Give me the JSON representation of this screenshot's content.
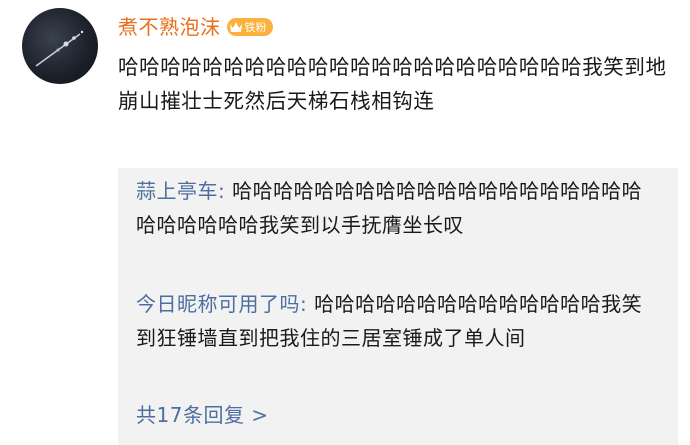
{
  "comment": {
    "username": "煮不熟泡沫",
    "badge_label": "铁粉",
    "avatar_icon": "avatar-icon",
    "text": "哈哈哈哈哈哈哈哈哈哈哈哈哈哈哈哈哈哈哈哈哈哈我笑到地崩山摧壮士死然后天梯石栈相钩连"
  },
  "replies": [
    {
      "author": "蒜上亭车",
      "separator": ": ",
      "text": "哈哈哈哈哈哈哈哈哈哈哈哈哈哈哈哈哈哈哈哈哈哈哈哈哈哈我笑到以手抚膺坐长叹"
    },
    {
      "author": "今日昵称可用了吗",
      "separator": ": ",
      "text": "哈哈哈哈哈哈哈哈哈哈哈哈哈哈我笑到狂锤墙直到把我住的三居室锤成了单人间"
    }
  ],
  "more_replies_label": "共17条回复 >",
  "colors": {
    "username": "#e8701f",
    "badge": "#fbb13c",
    "reply_name": "#4c6fa0",
    "reply_bg": "#f2f2f2",
    "text": "#1a1a1a"
  }
}
